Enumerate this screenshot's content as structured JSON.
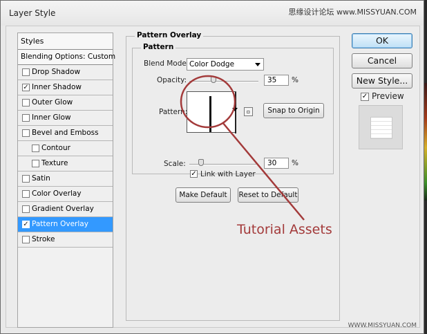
{
  "window": {
    "title": "Layer Style"
  },
  "watermark": {
    "top": "思缘设计论坛 www.MISSYUAN.COM",
    "bottom": "WWW.MISSYUAN.COM"
  },
  "styles_panel": {
    "header": "Styles",
    "blending": "Blending Options: Custom",
    "items": [
      {
        "label": "Drop Shadow",
        "checked": false,
        "indent": false,
        "selected": false
      },
      {
        "label": "Inner Shadow",
        "checked": true,
        "indent": false,
        "selected": false
      },
      {
        "label": "Outer Glow",
        "checked": false,
        "indent": false,
        "selected": false
      },
      {
        "label": "Inner Glow",
        "checked": false,
        "indent": false,
        "selected": false
      },
      {
        "label": "Bevel and Emboss",
        "checked": false,
        "indent": false,
        "selected": false
      },
      {
        "label": "Contour",
        "checked": false,
        "indent": true,
        "selected": false
      },
      {
        "label": "Texture",
        "checked": false,
        "indent": true,
        "selected": false
      },
      {
        "label": "Satin",
        "checked": false,
        "indent": false,
        "selected": false
      },
      {
        "label": "Color Overlay",
        "checked": false,
        "indent": false,
        "selected": false
      },
      {
        "label": "Gradient Overlay",
        "checked": false,
        "indent": false,
        "selected": false
      },
      {
        "label": "Pattern Overlay",
        "checked": true,
        "indent": false,
        "selected": true
      },
      {
        "label": "Stroke",
        "checked": false,
        "indent": false,
        "selected": false
      }
    ]
  },
  "pattern_overlay": {
    "group_title": "Pattern Overlay",
    "subgroup_title": "Pattern",
    "blend_mode_label": "Blend Mode:",
    "blend_mode_value": "Color Dodge",
    "opacity_label": "Opacity:",
    "opacity_value": "35",
    "opacity_unit": "%",
    "opacity_fraction": 0.35,
    "pattern_label": "Pattern:",
    "snap_button": "Snap to Origin",
    "scale_label": "Scale:",
    "scale_value": "30",
    "scale_unit": "%",
    "link_label": "Link with Layer",
    "link_checked": true,
    "make_default": "Make Default",
    "reset_default": "Reset to Default"
  },
  "side_buttons": {
    "ok": "OK",
    "cancel": "Cancel",
    "new_style": "New Style...",
    "preview_label": "Preview",
    "preview_checked": true
  },
  "annotation": {
    "text": "Tutorial Assets",
    "color": "#a33a3a"
  },
  "colors": {
    "selection": "#3399ff",
    "annotation": "#a33a3a"
  }
}
